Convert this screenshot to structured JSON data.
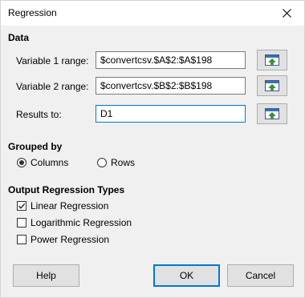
{
  "window": {
    "title": "Regression"
  },
  "data_section": {
    "title": "Data",
    "variable1": {
      "label": "Variable 1 range:",
      "value": "$convertcsv.$A$2:$A$198"
    },
    "variable2": {
      "label": "Variable 2 range:",
      "value": "$convertcsv.$B$2:$B$198"
    },
    "results": {
      "label": "Results to:",
      "value": "D1"
    }
  },
  "grouped_by": {
    "title": "Grouped by",
    "columns_label": "Columns",
    "rows_label": "Rows",
    "selected": "Columns"
  },
  "output_types": {
    "title": "Output Regression Types",
    "linear_label": "Linear Regression",
    "linear_checked": true,
    "logarithmic_label": "Logarithmic Regression",
    "logarithmic_checked": false,
    "power_label": "Power Regression",
    "power_checked": false
  },
  "buttons": {
    "help": "Help",
    "ok": "OK",
    "cancel": "Cancel"
  },
  "icons": {
    "close": "close-icon",
    "shrink": "shrink-range-icon",
    "check": "checkmark-icon"
  },
  "colors": {
    "focus_accent": "#0078d7",
    "dialog_bg": "#f0f0f0"
  }
}
